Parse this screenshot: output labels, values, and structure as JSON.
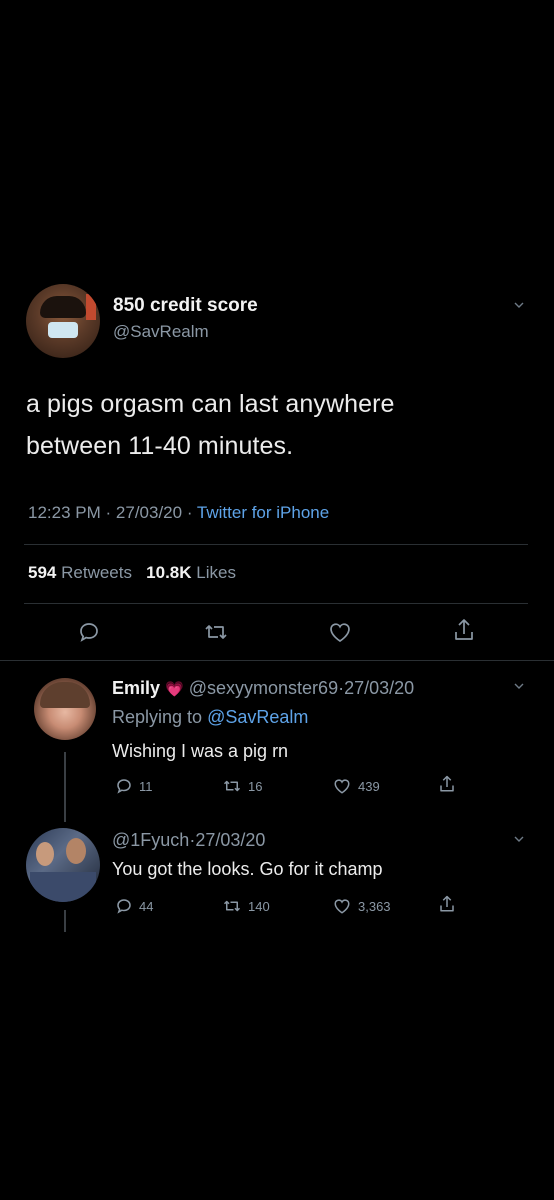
{
  "tweet": {
    "display_name": "850 credit score",
    "handle": "@SavRealm",
    "text_line1": "a pigs orgasm can last anywhere",
    "text_line2": "between 11-40 minutes.",
    "time": "12:23 PM",
    "dot1": "·",
    "date": "27/03/20",
    "dot2": "·",
    "source": "Twitter for iPhone",
    "retweets_count": "594",
    "retweets_label": "Retweets",
    "likes_count": "10.8K",
    "likes_label": "Likes",
    "actions": [
      "reply-icon",
      "retweet-icon",
      "like-icon",
      "share-icon"
    ]
  },
  "reply1": {
    "display_name": "Emily",
    "emoji": "💗",
    "handle": "@sexyymonster69",
    "dot": "·",
    "date": "27/03/20",
    "replying_prefix": "Replying to",
    "replying_handle": "@SavRealm",
    "text": "Wishing I was a pig rn",
    "replies": "11",
    "retweets": "16",
    "likes": "439"
  },
  "reply2": {
    "handle": "@1Fyuch",
    "dot": "·",
    "date": "27/03/20",
    "text": "You got the looks. Go for it champ",
    "replies": "44",
    "retweets": "140",
    "likes": "3,363"
  },
  "colors": {
    "background": "#000000",
    "text": "#e8e8e8",
    "muted": "#8b98a5",
    "link": "#5ea3e8",
    "divider": "#2a2f33"
  }
}
